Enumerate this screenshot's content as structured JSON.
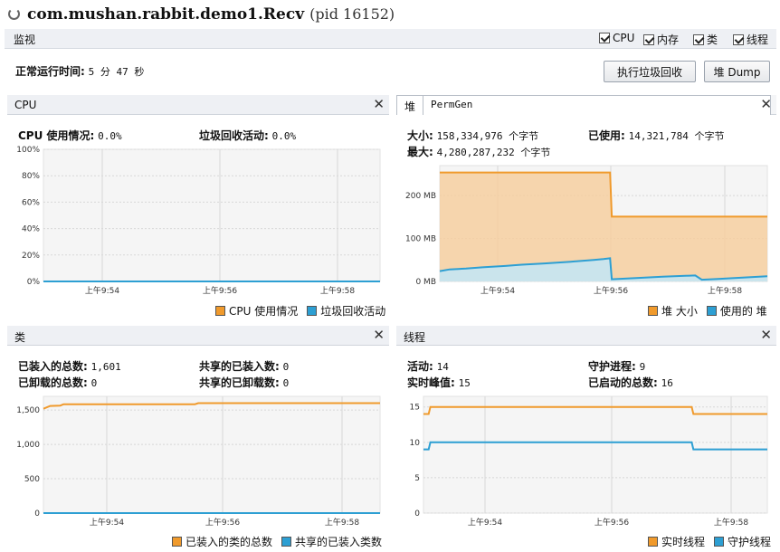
{
  "window": {
    "title": "com.mushan.rabbit.demo1.Recv",
    "pid": "(pid 16152)"
  },
  "monitor": {
    "label": "监视",
    "checks": [
      {
        "label": "CPU"
      },
      {
        "label": "内存"
      },
      {
        "label": "类"
      },
      {
        "label": "线程"
      }
    ],
    "uptime_label": "正常运行时间:",
    "uptime_value": "5 分 47 秒",
    "gc_button": "执行垃圾回收",
    "dump_button": "堆 Dump"
  },
  "colors": {
    "orange": "#f09a2c",
    "blue": "#2d9fd3"
  },
  "cpu": {
    "title": "CPU",
    "usage_label": "CPU 使用情况:",
    "usage_value": "0.0%",
    "gc_label": "垃圾回收活动:",
    "gc_value": "0.0%",
    "legend": [
      "CPU 使用情况",
      "垃圾回收活动"
    ]
  },
  "heap": {
    "tabs": [
      "堆",
      "PermGen"
    ],
    "size_label": "大小:",
    "size_value": "158,334,976 个字节",
    "used_label": "已使用:",
    "used_value": "14,321,784 个字节",
    "max_label": "最大:",
    "max_value": "4,280,287,232 个字节",
    "legend": [
      "堆 大小",
      "使用的 堆"
    ]
  },
  "classes": {
    "title": "类",
    "loaded_label": "已装入的总数:",
    "loaded_value": "1,601",
    "shared_loaded_label": "共享的已装入数:",
    "shared_loaded_value": "0",
    "unloaded_label": "已卸载的总数:",
    "unloaded_value": "0",
    "shared_unloaded_label": "共享的已卸载数:",
    "shared_unloaded_value": "0",
    "legend": [
      "已装入的类的总数",
      "共享的已装入类数"
    ]
  },
  "threads": {
    "title": "线程",
    "live_label": "活动:",
    "live_value": "14",
    "daemon_label": "守护进程:",
    "daemon_value": "9",
    "peak_label": "实时峰值:",
    "peak_value": "15",
    "started_label": "已启动的总数:",
    "started_value": "16",
    "legend": [
      "实时线程",
      "守护线程"
    ]
  },
  "chart_data": [
    {
      "type": "line",
      "name": "cpu",
      "x_ticks": [
        "上午9:54",
        "上午9:56",
        "上午9:58"
      ],
      "y_ticks": [
        "0%",
        "20%",
        "40%",
        "60%",
        "80%",
        "100%"
      ],
      "ylim": [
        0,
        100
      ],
      "series": [
        {
          "name": "CPU 使用情况",
          "x": [
            0,
            1
          ],
          "values": [
            0.0,
            0.0
          ]
        },
        {
          "name": "垃圾回收活动",
          "x": [
            0,
            1
          ],
          "values": [
            0.0,
            0.0
          ]
        }
      ]
    },
    {
      "type": "area",
      "name": "heap",
      "x_ticks": [
        "上午9:54",
        "上午9:56",
        "上午9:58"
      ],
      "y_ticks": [
        "0 MB",
        "100 MB",
        "200 MB"
      ],
      "ylim": [
        0,
        270
      ],
      "series": [
        {
          "name": "堆 大小",
          "x": [
            0,
            0.52,
            0.525,
            1
          ],
          "values": [
            254,
            254,
            151,
            151
          ]
        },
        {
          "name": "使用的 堆",
          "x": [
            0,
            0.03,
            0.08,
            0.13,
            0.2,
            0.25,
            0.32,
            0.4,
            0.47,
            0.5,
            0.52,
            0.525,
            0.6,
            0.68,
            0.75,
            0.78,
            0.8,
            0.85,
            0.9,
            0.95,
            1
          ],
          "values": [
            24,
            28,
            30,
            33,
            36,
            39,
            42,
            46,
            50,
            52,
            54,
            5,
            8,
            11,
            13,
            14,
            4,
            6,
            8,
            10,
            12
          ]
        }
      ]
    },
    {
      "type": "line",
      "name": "classes",
      "x_ticks": [
        "上午9:54",
        "上午9:56",
        "上午9:58"
      ],
      "y_ticks": [
        "0",
        "500",
        "1,000",
        "1,500"
      ],
      "ylim": [
        0,
        1700
      ],
      "series": [
        {
          "name": "已装入的类的总数",
          "x": [
            0,
            0.02,
            0.05,
            0.06,
            0.45,
            0.46,
            1
          ],
          "values": [
            1520,
            1560,
            1565,
            1585,
            1585,
            1601,
            1601
          ]
        },
        {
          "name": "共享的已装入类数",
          "x": [
            0,
            1
          ],
          "values": [
            0,
            0
          ]
        }
      ]
    },
    {
      "type": "line",
      "name": "threads",
      "x_ticks": [
        "上午9:54",
        "上午9:56",
        "上午9:58"
      ],
      "y_ticks": [
        "0",
        "5",
        "10",
        "15"
      ],
      "ylim": [
        0,
        16.5
      ],
      "series": [
        {
          "name": "实时线程",
          "x": [
            0,
            0.015,
            0.02,
            0.78,
            0.785,
            1
          ],
          "values": [
            14,
            14,
            15,
            15,
            14,
            14
          ]
        },
        {
          "name": "守护线程",
          "x": [
            0,
            0.015,
            0.02,
            0.78,
            0.785,
            1
          ],
          "values": [
            9,
            9,
            10,
            10,
            9,
            9
          ]
        }
      ]
    }
  ]
}
